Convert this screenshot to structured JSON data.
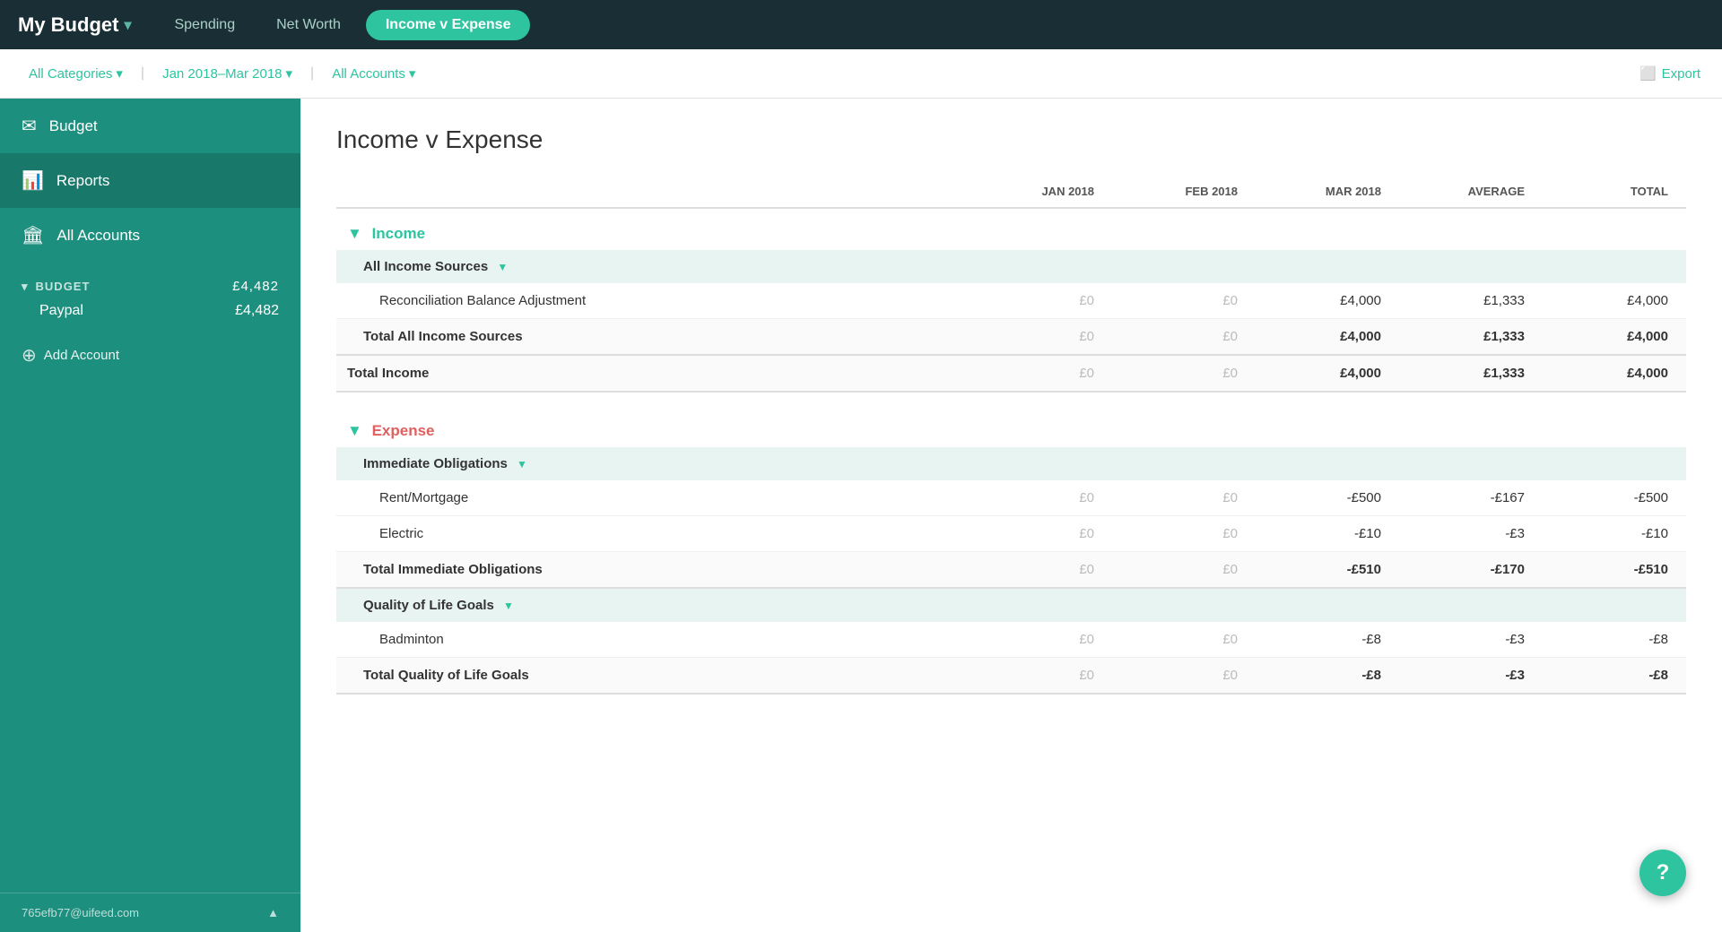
{
  "brand": {
    "name": "My Budget",
    "chevron": "▾"
  },
  "top_nav": {
    "links": [
      {
        "id": "spending",
        "label": "Spending",
        "active": false
      },
      {
        "id": "net-worth",
        "label": "Net Worth",
        "active": false
      },
      {
        "id": "income-expense",
        "label": "Income v Expense",
        "active": true
      }
    ]
  },
  "filter_bar": {
    "categories_label": "All Categories",
    "date_range_label": "Jan 2018–Mar 2018",
    "accounts_label": "All Accounts",
    "export_label": "Export",
    "chevron": "▾"
  },
  "sidebar": {
    "budget_label": "Budget",
    "reports_label": "Reports",
    "all_accounts_label": "All Accounts",
    "budget_section_label": "BUDGET",
    "budget_section_chevron": "▾",
    "accounts": [
      {
        "name": "Paypal",
        "amount": "£4,482"
      }
    ],
    "budget_total": "£4,482",
    "add_account_label": "Add Account",
    "footer_email": "765efb77@uifeed.com",
    "footer_chevron": "▲"
  },
  "page": {
    "title": "Income v Expense"
  },
  "columns": {
    "label": "",
    "jan": "JAN 2018",
    "feb": "FEB 2018",
    "mar": "MAR 2018",
    "average": "AVERAGE",
    "total": "TOTAL"
  },
  "income_section": {
    "label": "Income",
    "collapse_icon": "▼",
    "groups": [
      {
        "id": "all-income-sources",
        "label": "All Income Sources",
        "collapse_icon": "▼",
        "rows": [
          {
            "label": "Reconciliation Balance Adjustment",
            "jan": "£0",
            "feb": "£0",
            "mar": "£4,000",
            "average": "£1,333",
            "total": "£4,000",
            "jan_dim": true,
            "feb_dim": true
          }
        ],
        "total_row": {
          "label": "Total All Income Sources",
          "jan": "£0",
          "feb": "£0",
          "mar": "£4,000",
          "average": "£1,333",
          "total": "£4,000",
          "jan_dim": true,
          "feb_dim": true
        }
      }
    ],
    "total_row": {
      "label": "Total Income",
      "jan": "£0",
      "feb": "£0",
      "mar": "£4,000",
      "average": "£1,333",
      "total": "£4,000",
      "jan_dim": true,
      "feb_dim": true
    }
  },
  "expense_section": {
    "label": "Expense",
    "collapse_icon": "▼",
    "groups": [
      {
        "id": "immediate-obligations",
        "label": "Immediate Obligations",
        "collapse_icon": "▼",
        "rows": [
          {
            "label": "Rent/Mortgage",
            "jan": "£0",
            "feb": "£0",
            "mar": "-£500",
            "average": "-£167",
            "total": "-£500",
            "jan_dim": true,
            "feb_dim": true,
            "negative": true
          },
          {
            "label": "Electric",
            "jan": "£0",
            "feb": "£0",
            "mar": "-£10",
            "average": "-£3",
            "total": "-£10",
            "jan_dim": true,
            "feb_dim": true,
            "negative": true
          }
        ],
        "total_row": {
          "label": "Total Immediate Obligations",
          "jan": "£0",
          "feb": "£0",
          "mar": "-£510",
          "average": "-£170",
          "total": "-£510",
          "jan_dim": true,
          "feb_dim": true,
          "negative": true
        }
      },
      {
        "id": "quality-of-life",
        "label": "Quality of Life Goals",
        "collapse_icon": "▼",
        "rows": [
          {
            "label": "Badminton",
            "jan": "£0",
            "feb": "£0",
            "mar": "-£8",
            "average": "-£3",
            "total": "-£8",
            "jan_dim": true,
            "feb_dim": true,
            "negative": true
          }
        ],
        "total_row": {
          "label": "Total Quality of Life Goals",
          "jan": "£0",
          "feb": "£0",
          "mar": "-£8",
          "average": "-£3",
          "total": "-£8",
          "jan_dim": true,
          "feb_dim": true,
          "negative": true
        }
      }
    ]
  },
  "help_button_label": "?"
}
